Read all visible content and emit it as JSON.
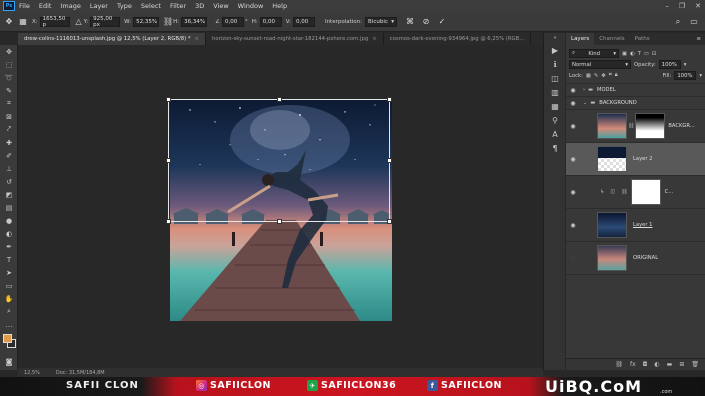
{
  "menu": [
    "File",
    "Edit",
    "Image",
    "Layer",
    "Type",
    "Select",
    "Filter",
    "3D",
    "View",
    "Window",
    "Help"
  ],
  "options": {
    "x_label": "X:",
    "x_value": "1653,50 p",
    "y_label": "Y:",
    "y_value": "925,00 px",
    "w_label": "W:",
    "w_value": "52,35%",
    "h_label": "H:",
    "h_value": "36,34%",
    "angle_value": "0,00",
    "hskew_label": "H:",
    "hskew_value": "0,00",
    "vskew_label": "V:",
    "vskew_value": "0,00",
    "interp_label": "Interpolation:",
    "interp_value": "Bicubic"
  },
  "tabs": [
    {
      "label": "drew-colins-1116013-unsplash.jpg @ 12,5% (Layer 2, RGB/8) *",
      "active": true
    },
    {
      "label": "horizon-sky-sunset-road-night-star-182144-pxhere.com.jpg",
      "active": false
    },
    {
      "label": "cosmos-dark-evening-934964.jpg @ 6,25% (RGB...",
      "active": false
    }
  ],
  "status": {
    "zoom": "12,5%",
    "doc": "Doc: 31,5M/184,8M"
  },
  "panel": {
    "tabs": [
      "Layers",
      "Channels",
      "Paths"
    ],
    "kind_label": "Kind",
    "blend_mode": "Normal",
    "opacity_label": "Opacity:",
    "opacity_value": "100%",
    "lock_label": "Lock:",
    "fill_label": "Fill:",
    "fill_value": "100%",
    "layers": [
      {
        "name": "MODEL",
        "type": "group"
      },
      {
        "name": "BACKGROUND",
        "type": "group"
      },
      {
        "name": "BACKGR...",
        "type": "masked"
      },
      {
        "name": "Layer 2",
        "type": "selected"
      },
      {
        "name": "C...",
        "type": "adjustment"
      },
      {
        "name": "Layer 1",
        "type": "layer"
      },
      {
        "name": "ORIGINAL",
        "type": "layer"
      }
    ]
  },
  "banner": {
    "name": "SAFII CLON",
    "instagram": "SAFIICLON",
    "snapchat": "SAFIICLON36",
    "facebook": "SAFIICLON",
    "brand": "UiBQ.CoM",
    "brand_sub": ".com"
  }
}
